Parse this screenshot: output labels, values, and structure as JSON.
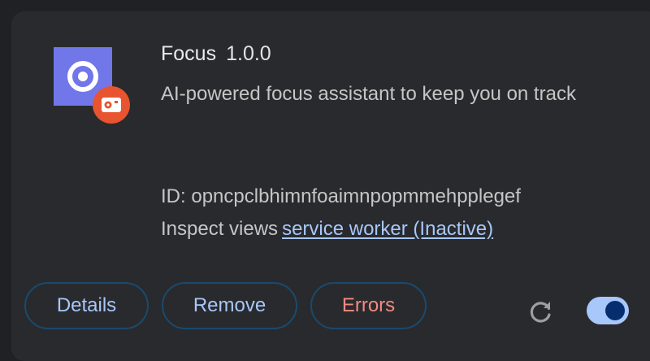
{
  "extension": {
    "name": "Focus",
    "version": "1.0.0",
    "description": "AI-powered focus assistant to keep you on track",
    "id_label": "ID:",
    "id": "opncpclbhimnfoaimnpopmmehpplegef",
    "inspect_label": "Inspect views",
    "inspect_link": "service worker (Inactive)",
    "enabled": true
  },
  "buttons": {
    "details": "Details",
    "remove": "Remove",
    "errors": "Errors"
  },
  "icons": {
    "extension_icon": "focus-target-icon",
    "badge": "policy-badge-icon",
    "reload": "reload-icon"
  },
  "colors": {
    "link": "#a8c7fa",
    "errors": "#f28b82",
    "icon_bg": "#7177e8",
    "badge_bg": "#e8542f",
    "toggle_on": "#a8c7fa"
  }
}
